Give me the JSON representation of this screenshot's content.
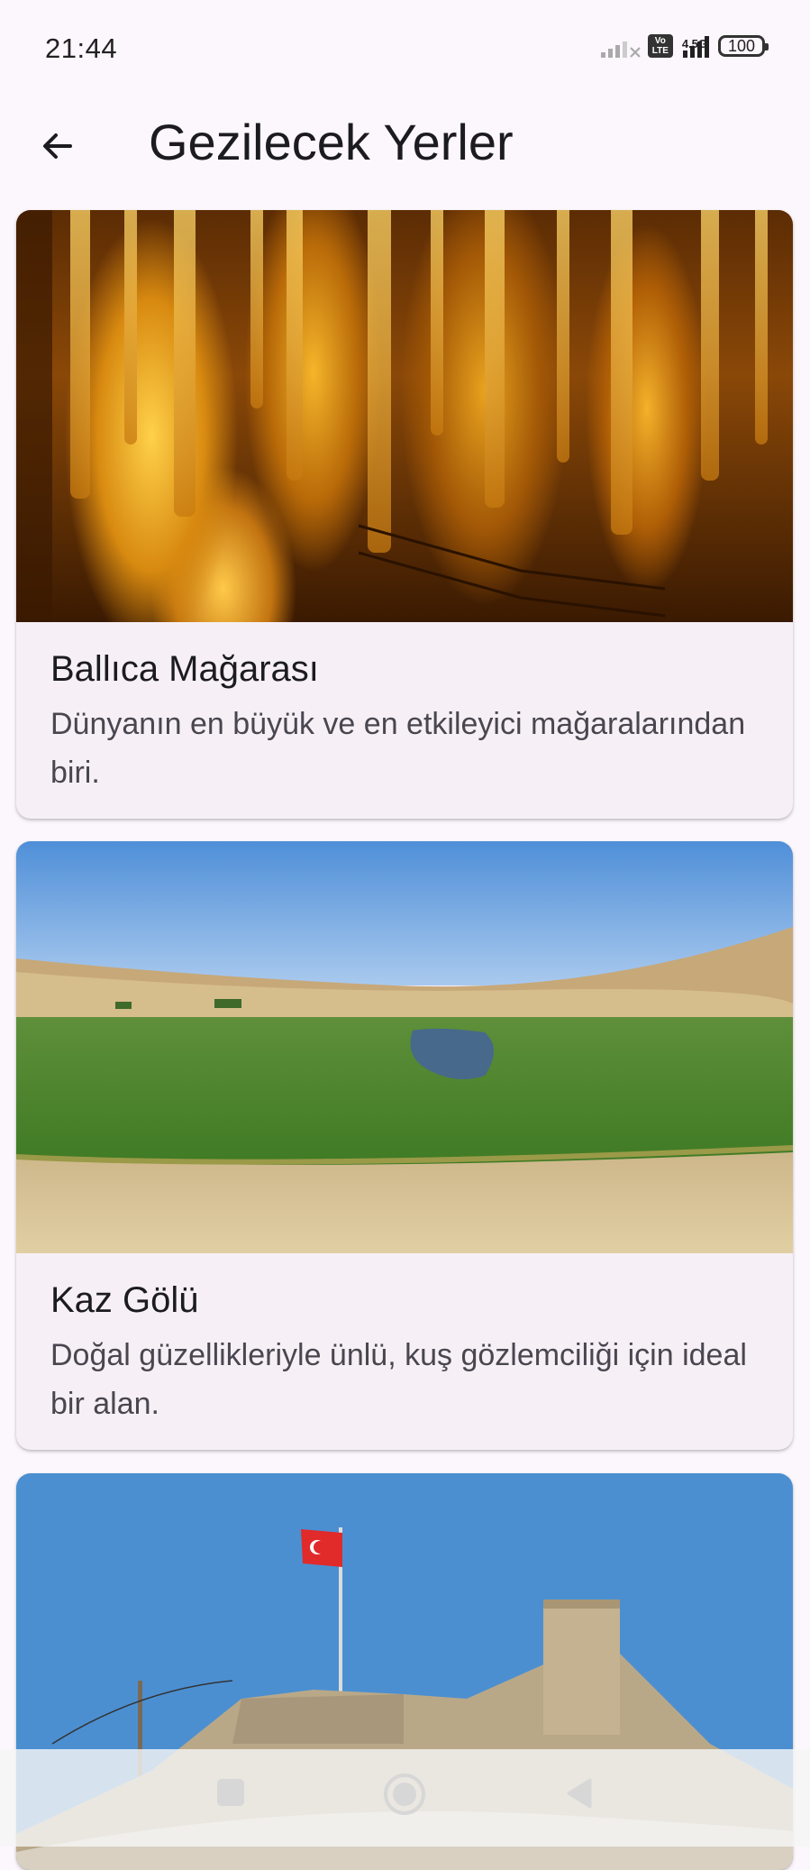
{
  "status_bar": {
    "time": "21:44",
    "network": "4.5G",
    "volte": "Vo LTE",
    "battery": "100"
  },
  "app_bar": {
    "title": "Gezilecek Yerler"
  },
  "places": [
    {
      "title": "Ballıca Mağarası",
      "description": "Dünyanın en büyük ve en etkileyici mağaralarından biri."
    },
    {
      "title": "Kaz Gölü",
      "description": "Doğal güzellikleriyle ünlü, kuş gözlemciliği için ideal bir alan."
    }
  ],
  "colors": {
    "background": "#fcf7fc",
    "card": "#f6f0f6",
    "title_text": "#1c1b1f",
    "body_text": "#4a4650"
  },
  "icons": {
    "back": "arrow-left",
    "nav_recents": "square",
    "nav_home": "circle",
    "nav_back": "triangle-left"
  }
}
